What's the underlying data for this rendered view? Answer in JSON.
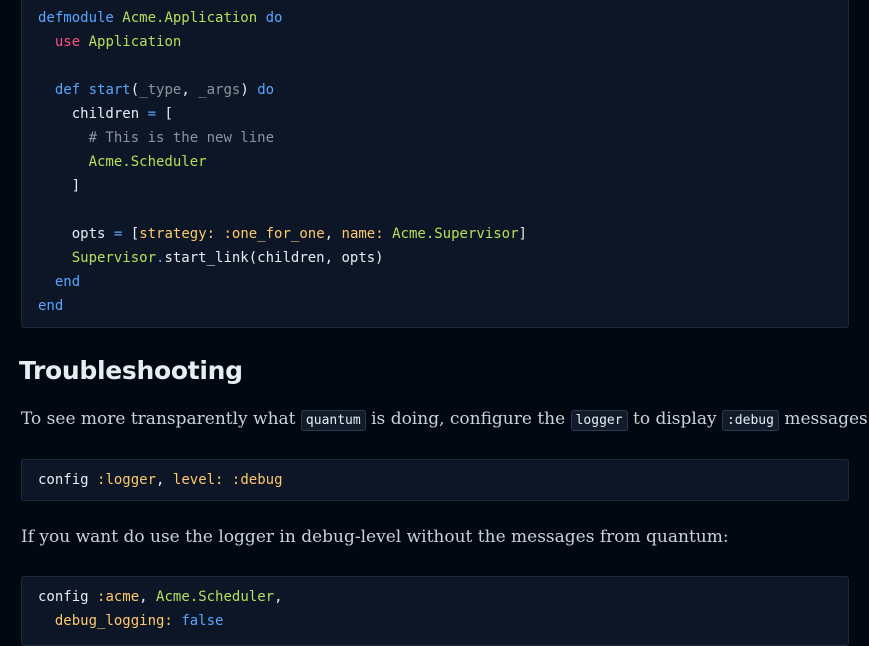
{
  "code1": {
    "l1": {
      "kw": "defmodule",
      "mod": "Acme.Application",
      "do": "do"
    },
    "l2": {
      "use": "use",
      "mod": "Application"
    },
    "l4": {
      "def": "def",
      "fname": "start",
      "open": "(",
      "a1": "_type",
      "sep": ", ",
      "a2": "_args",
      "close": ")",
      "do": "do"
    },
    "l5": {
      "var": "children",
      "eq": "=",
      "br": "["
    },
    "l6": {
      "comment": "# This is the new line"
    },
    "l7": {
      "mod": "Acme.Scheduler"
    },
    "l8": {
      "br": "]"
    },
    "l10": {
      "var": "opts",
      "eq": "=",
      "open": "[",
      "k1": "strategy:",
      "v1": ":one_for_one",
      "comma": ",",
      "k2": "name:",
      "v2": "Acme.Supervisor",
      "close": "]"
    },
    "l11": {
      "mod": "Supervisor",
      "dot": ".",
      "call": "start_link(children, opts)"
    },
    "l12": {
      "end": "end"
    },
    "l13": {
      "end": "end"
    }
  },
  "heading": "Troubleshooting",
  "para1": {
    "t1": "To see more transparently what",
    "c1": "quantum",
    "t2": "is doing, configure the",
    "c2": "logger",
    "t3": "to display",
    "c3": ":debug",
    "t4": "messages."
  },
  "code2": {
    "config": "config",
    "atom": ":logger",
    "comma": ",",
    "key": "level:",
    "val": ":debug"
  },
  "para2": "If you want do use the logger in debug-level without the messages from quantum:",
  "code3": {
    "l1": {
      "config": "config",
      "atom": ":acme",
      "comma1": ",",
      "mod": "Acme.Scheduler",
      "comma2": ","
    },
    "l2": {
      "key": "debug_logging:",
      "val": "false"
    }
  },
  "colors": {
    "background": "#020812",
    "code_bg": "#0c1626",
    "keyword": "#58a6ff",
    "module": "#b3e05a",
    "atom": "#ffc96b",
    "use": "#ff4f86",
    "comment": "#8b949e"
  }
}
